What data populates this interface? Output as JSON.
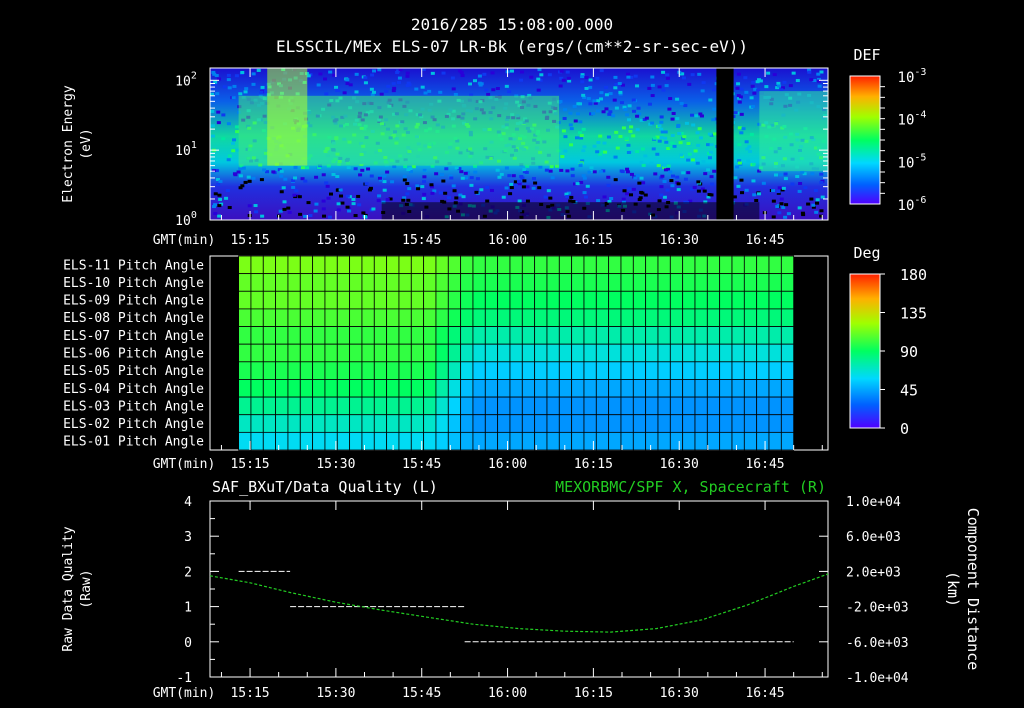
{
  "header": {
    "title": "2016/285 15:08:00.000",
    "subtitle": "ELSSCIL/MEx ELS-07 LR-Bk  (ergs/(cm**2-sr-sec-eV))"
  },
  "chart_data": [
    {
      "type": "heatmap",
      "name": "energy-spectrogram",
      "ylabel": "Electron Energy",
      "yunit": "(eV)",
      "y_scale": "log",
      "ylim": [
        1,
        150
      ],
      "y_ticks": [
        {
          "value": 1,
          "label": "10^0"
        },
        {
          "value": 10,
          "label": "10^1"
        },
        {
          "value": 100,
          "label": "10^2"
        }
      ],
      "xaxis_label": "GMT(min)",
      "x_ticks": [
        "15:15",
        "15:30",
        "15:45",
        "16:00",
        "16:15",
        "16:30",
        "16:45"
      ],
      "x_tick_minutes": [
        915,
        930,
        945,
        960,
        975,
        990,
        1005
      ],
      "xlim_minutes": [
        908,
        1016
      ],
      "colorbar": {
        "label": "DEF",
        "scale": "log",
        "ticks": [
          {
            "value": 0.001,
            "label": "10^-3"
          },
          {
            "value": 0.0001,
            "label": "10^-4"
          },
          {
            "value": 1e-05,
            "label": "10^-5"
          },
          {
            "value": 1e-06,
            "label": "10^-6"
          }
        ]
      }
    },
    {
      "type": "heatmap",
      "name": "pitch-angle",
      "rows": [
        "ELS-11 Pitch Angle",
        "ELS-10 Pitch Angle",
        "ELS-09 Pitch Angle",
        "ELS-08 Pitch Angle",
        "ELS-07 Pitch Angle",
        "ELS-06 Pitch Angle",
        "ELS-05 Pitch Angle",
        "ELS-04 Pitch Angle",
        "ELS-03 Pitch Angle",
        "ELS-02 Pitch Angle",
        "ELS-01 Pitch Angle"
      ],
      "row_values_early_deg": [
        115,
        110,
        110,
        105,
        100,
        100,
        95,
        90,
        80,
        70,
        60
      ],
      "row_values_late_deg": [
        100,
        95,
        90,
        85,
        75,
        65,
        55,
        45,
        40,
        40,
        45
      ],
      "transition_minutes": [
        946,
        954
      ],
      "data_range_minutes": [
        913,
        1010
      ],
      "xaxis_label": "GMT(min)",
      "x_ticks": [
        "15:15",
        "15:30",
        "15:45",
        "16:00",
        "16:15",
        "16:30",
        "16:45"
      ],
      "colorbar": {
        "label": "Deg",
        "ticks": [
          {
            "value": 180,
            "label": "180"
          },
          {
            "value": 135,
            "label": "135"
          },
          {
            "value": 90,
            "label": "90"
          },
          {
            "value": 45,
            "label": "45"
          },
          {
            "value": 0,
            "label": "0"
          }
        ]
      }
    },
    {
      "type": "line",
      "name": "data-quality-and-distance",
      "title_left": "SAF_BXuT/Data Quality (L)",
      "title_right": "MEXORBMC/SPF X, Spacecraft (R)",
      "ylabel_left": "Raw Data Quality",
      "yunit_left": "(Raw)",
      "ylim_left": [
        -1,
        4
      ],
      "y_ticks_left": [
        "4",
        "3",
        "2",
        "1",
        "0",
        "-1"
      ],
      "ylabel_right": "Component Distance",
      "yunit_right": "(km)",
      "ylim_right": [
        -10000,
        10000
      ],
      "y_ticks_right": [
        {
          "value": 10000,
          "label": "1.0e+04"
        },
        {
          "value": 6000,
          "label": "6.0e+03"
        },
        {
          "value": 2000,
          "label": "2.0e+03"
        },
        {
          "value": -2000,
          "label": "-2.0e+03"
        },
        {
          "value": -6000,
          "label": "-6.0e+03"
        },
        {
          "value": -10000,
          "label": "-1.0e+04"
        }
      ],
      "xaxis_label": "GMT(min)",
      "x_ticks": [
        "15:15",
        "15:30",
        "15:45",
        "16:00",
        "16:15",
        "16:30",
        "16:45"
      ],
      "series": [
        {
          "name": "SAF_BXuT/Data Quality",
          "axis": "left",
          "color": "#ffffff",
          "segments": [
            {
              "x": [
                913,
                922
              ],
              "y": 2
            },
            {
              "x": [
                922,
                952.5
              ],
              "y": 1
            },
            {
              "x": [
                952.5,
                1010
              ],
              "y": 0
            }
          ]
        },
        {
          "name": "MEXORBMC/SPF X, Spacecraft",
          "axis": "right",
          "color": "#22cc22",
          "x": [
            908,
            915,
            922,
            930,
            938,
            946,
            954,
            962,
            970,
            978,
            986,
            994,
            1002,
            1010,
            1016
          ],
          "y": [
            1500,
            700,
            -400,
            -1500,
            -2400,
            -3200,
            -4000,
            -4500,
            -4800,
            -4900,
            -4500,
            -3500,
            -1800,
            300,
            1700
          ]
        }
      ]
    }
  ]
}
